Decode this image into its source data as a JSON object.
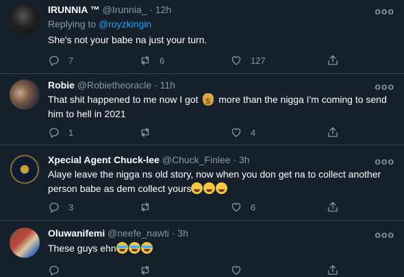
{
  "tweets": [
    {
      "name": "IRUNNIA ™",
      "handle": "@Irunnia_",
      "sep": "·",
      "time": "12h",
      "replying_prefix": "Replying to ",
      "replying_to": "@royzkingin",
      "text": "She's not your babe na just your turn.",
      "replies": "7",
      "retweets": "6",
      "likes": "127",
      "more": "ooo"
    },
    {
      "name": "Robie",
      "handle": "@Robietheoracle",
      "sep": "·",
      "time": "11h",
      "text_a": "That shit happened to me now I got ",
      "emoji_a": "money-bag",
      "text_b": " more than the nigga I'm coming to send him to hell in 2021",
      "replies": "1",
      "retweets": "",
      "likes": "4",
      "more": "ooo"
    },
    {
      "name": "Xpecial Agent Chuck-lee",
      "handle": "@Chuck_Finlee",
      "sep": "·",
      "time": "3h",
      "text": "Alaye leave the nigga ns old story, now when you don get na to collect another person babe as dem collect yours",
      "emojis": [
        "rolling-laughing",
        "rolling-laughing",
        "rolling-laughing"
      ],
      "replies": "3",
      "retweets": "",
      "likes": "6",
      "more": "ooo"
    },
    {
      "name": "Oluwanifemi",
      "handle": "@neefe_nawti",
      "sep": "·",
      "time": "3h",
      "text": "These guys ehn",
      "emojis": [
        "tears-of-joy",
        "tears-of-joy",
        "tears-of-joy"
      ],
      "replies": "",
      "retweets": "",
      "likes": "",
      "more": "ooo"
    }
  ],
  "colors": {
    "background": "#15202b",
    "divider": "#38444d",
    "muted": "#8899a6",
    "link": "#1da1f2",
    "text": "#ffffff"
  }
}
